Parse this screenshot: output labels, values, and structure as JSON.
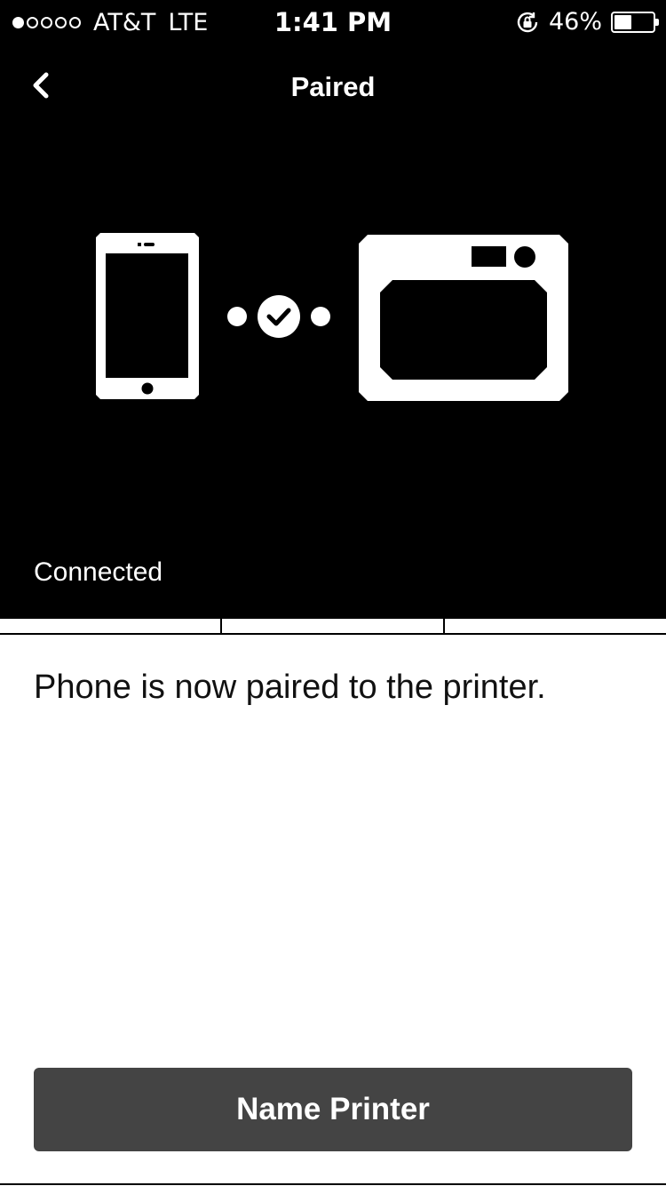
{
  "status_bar": {
    "signal_strength": 1,
    "signal_max": 5,
    "carrier": "AT&T",
    "network": "LTE",
    "time": "1:41 PM",
    "battery_percent": "46%",
    "battery_level": 0.46
  },
  "nav": {
    "title": "Paired",
    "back_icon": "chevron-left-icon"
  },
  "illustration": {
    "device_icon": "phone-icon",
    "link_icon": "checkmark-icon",
    "target_icon": "printer-icon"
  },
  "connection_status": "Connected",
  "message": "Phone is now paired to the printer.",
  "actions": {
    "primary_label": "Name Printer"
  },
  "colors": {
    "hero_background": "#000000",
    "button_background": "#444444",
    "text_primary": "#111111"
  }
}
